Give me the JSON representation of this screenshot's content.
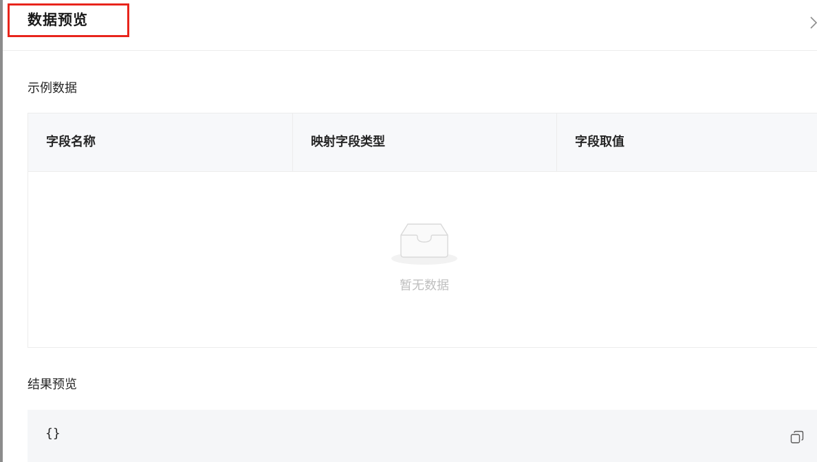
{
  "panel": {
    "title": "数据预览",
    "close_icon": "chevron-right-icon"
  },
  "sample_section": {
    "title": "示例数据",
    "table": {
      "columns": [
        "字段名称",
        "映射字段类型",
        "字段取值"
      ],
      "rows": [],
      "empty_text": "暂无数据",
      "empty_icon": "empty-inbox-icon"
    }
  },
  "result_section": {
    "title": "结果预览",
    "code": "{}",
    "copy_icon": "copy-icon"
  },
  "colors": {
    "highlight_border": "#e8241b",
    "table_header_bg": "#f7f8fa",
    "code_bg": "#f5f6f8",
    "empty_text": "#bfbfbf"
  }
}
